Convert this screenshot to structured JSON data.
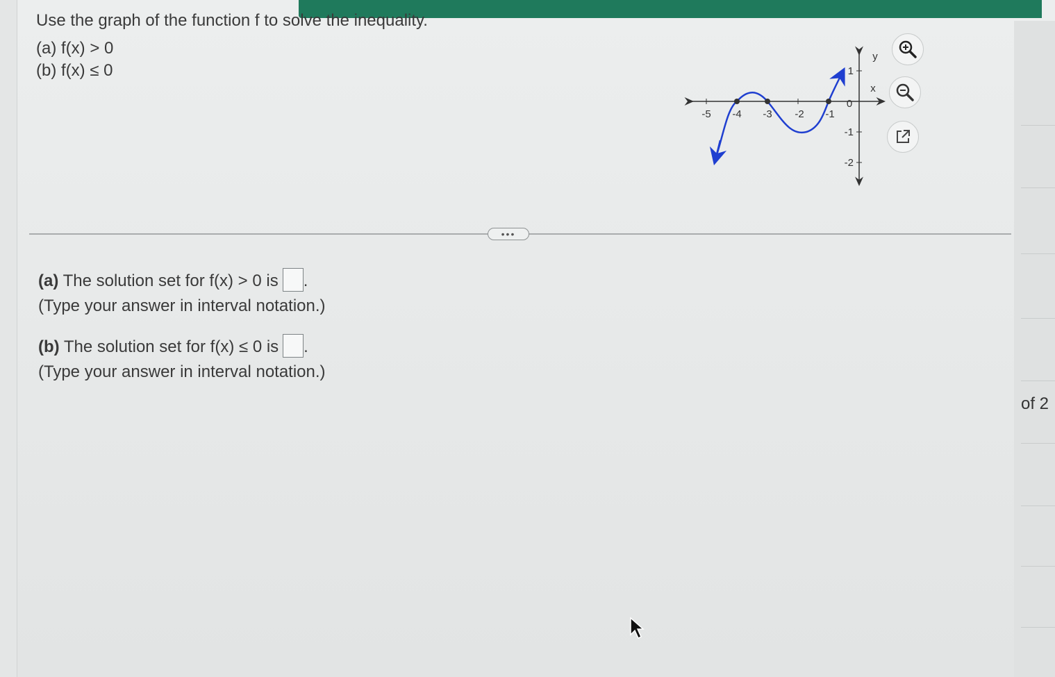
{
  "question": {
    "prompt": "Use the graph of the function f to solve the inequality.",
    "part_a": "(a) f(x) > 0",
    "part_b": "(b) f(x) ≤ 0"
  },
  "graph": {
    "x_ticks": [
      "-5",
      "-4",
      "-3",
      "-2",
      "-1",
      "0"
    ],
    "y_ticks": [
      "1",
      "-1",
      "-2"
    ],
    "x_axis_label": "x",
    "y_axis_label": "y",
    "zero_points_x": [
      -4,
      -3,
      -1
    ],
    "curve_color": "#1f3fd0"
  },
  "tools": {
    "zoom_in_icon": "zoom-in-icon",
    "zoom_out_icon": "zoom-out-icon",
    "open_external_icon": "external-link-icon"
  },
  "divider": {
    "more_label": "•••"
  },
  "answers": {
    "a_label": "(a)",
    "a_text": "The solution set for f(x) > 0 is",
    "a_hint": "(Type your answer in interval notation.)",
    "b_label": "(b)",
    "b_text": "The solution set for f(x) ≤ 0 is",
    "b_hint": "(Type your answer in interval notation.)",
    "a_value": "",
    "b_value": ""
  },
  "pagination": {
    "text": "of 2"
  },
  "colors": {
    "top_bar": "#1f7a5c",
    "curve": "#1f3fd0"
  }
}
